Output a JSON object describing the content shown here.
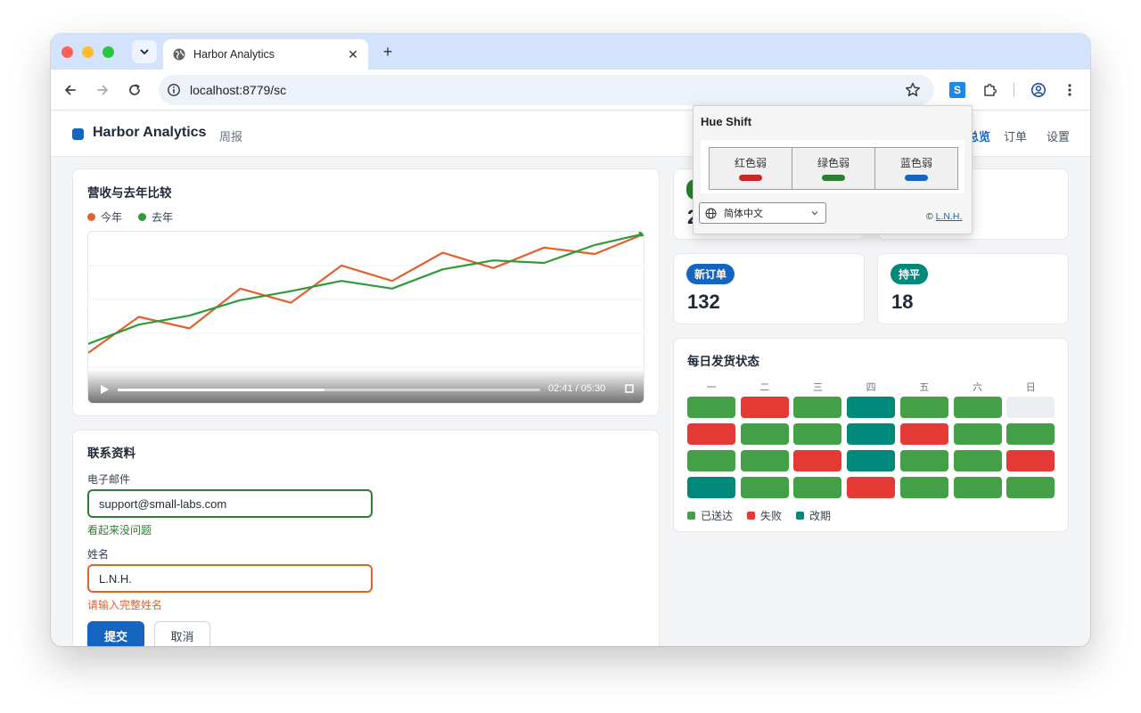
{
  "browser": {
    "tab_title": "Harbor Analytics",
    "tab_close": "✕",
    "new_tab": "+",
    "url": "localhost:8779/sc",
    "extension_letter": "S"
  },
  "app": {
    "name": "Harbor Analytics",
    "subtitle": "周报",
    "nav": [
      {
        "label": "总览"
      },
      {
        "label": "订单"
      },
      {
        "label": "设置"
      }
    ],
    "brand_color": "#1565c0"
  },
  "revenue_card": {
    "title": "营收与去年比较",
    "legend": [
      {
        "label": "今年",
        "color": "#e0622c"
      },
      {
        "label": "去年",
        "color": "#2e9a3a"
      }
    ],
    "video": {
      "time": "02:41 / 05:30",
      "progress": 0.49
    }
  },
  "chart_data": {
    "type": "line",
    "title": "营收与去年比较",
    "xlabel": "",
    "ylabel": "",
    "grid": true,
    "legend_placement": "top-left",
    "x": [
      0,
      1,
      2,
      3,
      4,
      5,
      6,
      7,
      8,
      9,
      10,
      11
    ],
    "ylim": [
      0,
      100
    ],
    "series": [
      {
        "name": "今年",
        "color": "#e0622c",
        "values": [
          14,
          42,
          33,
          64,
          53,
          82,
          70,
          92,
          80,
          96,
          91,
          107
        ]
      },
      {
        "name": "去年",
        "color": "#2e9a3a",
        "values": [
          21,
          36,
          43,
          55,
          62,
          70,
          64,
          79,
          86,
          84,
          98,
          107
        ]
      }
    ]
  },
  "contact_form": {
    "title": "联系资料",
    "email": {
      "label": "电子邮件",
      "value": "support@small-labs.com",
      "message": "看起来没问题",
      "state_color": "#2e7d32"
    },
    "name": {
      "label": "姓名",
      "value": "L.N.H.",
      "message": "请输入完整姓名",
      "state_color": "#e0622c"
    },
    "submit_label": "提交",
    "cancel_label": "取消"
  },
  "kpis": [
    {
      "badge": "",
      "value": "2",
      "color": "#2e7d32"
    },
    {
      "badge": "",
      "value": "",
      "color": "#00897b"
    },
    {
      "badge": "新订单",
      "value": "132",
      "color": "#1565c0"
    },
    {
      "badge": "持平",
      "value": "18",
      "color": "#00897b"
    }
  ],
  "shipping": {
    "title": "每日发货状态",
    "days": [
      "一",
      "二",
      "三",
      "四",
      "五",
      "六",
      "日"
    ],
    "colors": {
      "delivered": "#43a047",
      "failed": "#e53935",
      "rescheduled": "#00897b",
      "empty": "#eceef1"
    },
    "grid": [
      [
        "delivered",
        "failed",
        "delivered",
        "rescheduled",
        "delivered",
        "delivered",
        "empty"
      ],
      [
        "failed",
        "delivered",
        "delivered",
        "rescheduled",
        "failed",
        "delivered",
        "delivered"
      ],
      [
        "delivered",
        "delivered",
        "failed",
        "rescheduled",
        "delivered",
        "delivered",
        "failed"
      ],
      [
        "rescheduled",
        "delivered",
        "delivered",
        "failed",
        "delivered",
        "delivered",
        "delivered"
      ]
    ],
    "legend": [
      {
        "label": "已送达",
        "color": "#43a047"
      },
      {
        "label": "失败",
        "color": "#e53935"
      },
      {
        "label": "改期",
        "color": "#00897b"
      }
    ]
  },
  "hue_popup": {
    "title": "Hue Shift",
    "modes": [
      {
        "label": "红色弱",
        "color": "#c62828"
      },
      {
        "label": "绿色弱",
        "color": "#2e7d32"
      },
      {
        "label": "蓝色弱",
        "color": "#1565c0"
      }
    ],
    "language": "简体中文",
    "credit_prefix": "©",
    "credit_link": "L.N.H."
  }
}
